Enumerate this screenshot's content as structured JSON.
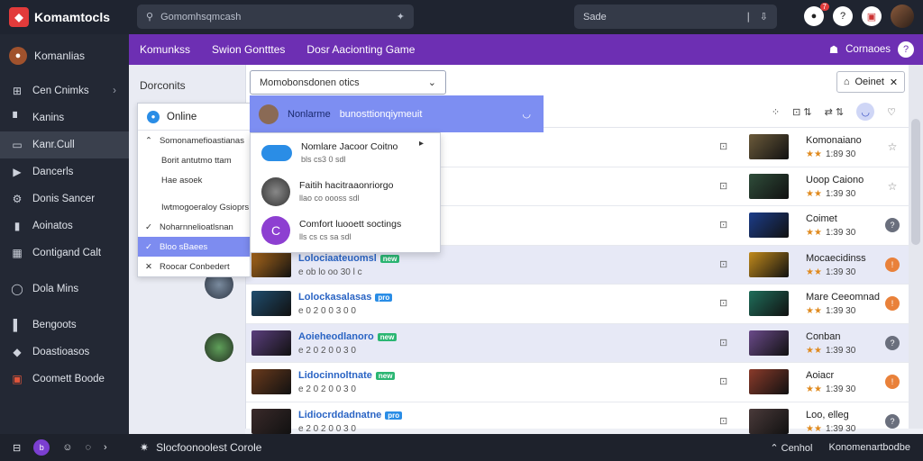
{
  "header": {
    "app_name": "Komamtocls",
    "search_placeholder": "Gomomhsqmcash",
    "search2_label": "Sade",
    "notif_count": "7"
  },
  "sidebar": {
    "user_name": "Komanlias",
    "items": [
      {
        "label": "Cen Cnimks",
        "icon": "game-controller-icon",
        "chevron": true
      },
      {
        "label": "Kanins",
        "icon": "trophy-icon"
      },
      {
        "label": "Kanr.Cull",
        "icon": "monitor-icon",
        "active": true
      },
      {
        "label": "Dancerls",
        "icon": "play-icon"
      },
      {
        "label": "Donis Sancer",
        "icon": "gear-icon"
      },
      {
        "label": "Aoinatos",
        "icon": "bookmark-icon"
      },
      {
        "label": "Contigand Calt",
        "icon": "calendar-icon"
      },
      {
        "label": "Dola Mins",
        "icon": "chat-icon"
      },
      {
        "label": "Bengoots",
        "icon": "book-icon"
      },
      {
        "label": "Doastioasos",
        "icon": "tag-icon"
      },
      {
        "label": "Coomett Boode",
        "icon": "badge-icon"
      }
    ]
  },
  "nav": {
    "tabs": [
      "Komunkss",
      "Swion Gontttes",
      "Dosr Aacionting Game"
    ],
    "right_label": "Cornaoes"
  },
  "left_panel": {
    "title": "Dorconits",
    "online_label": "Online",
    "items": [
      {
        "label": "Somonamefioastianas",
        "mark": "^"
      },
      {
        "label": "Borit antutmo ttam",
        "mark": ""
      },
      {
        "label": "Hae asoek",
        "mark": ""
      },
      {
        "label": "Iwtmogoeraloy Gsioprs",
        "mark": ""
      },
      {
        "label": "Noharnnelioatlsnan",
        "mark": "check"
      },
      {
        "label": "Bloo sBaees",
        "mark": "check",
        "selected": true
      },
      {
        "label": "Roocar Conbedert",
        "mark": "x"
      }
    ]
  },
  "main": {
    "select_value": "Momobonsdonen otics",
    "online_btn": "Oeinet",
    "highlight_row": {
      "name": "Nonlarme",
      "meta": "bunosttionqiymeuit"
    },
    "popup": [
      {
        "title": "Nomlare Jacoor Coitno",
        "sub": "bls cs3 0 sdl"
      },
      {
        "title": "Faitih hacitraaonriorgo",
        "sub": "llao co oooss sdl"
      },
      {
        "title": "Comfort luooett soctings",
        "sub": "lls cs cs sa sdl"
      }
    ],
    "rows": [
      {
        "title": "",
        "sub": "",
        "tag": "",
        "right_title": "Komonaiano",
        "rating": "1:89 30",
        "end": "star"
      },
      {
        "title": "",
        "sub": "",
        "tag": "",
        "right_title": "Uoop Caiono",
        "rating": "1:39 30",
        "end": "star"
      },
      {
        "title": "",
        "sub": "",
        "tag": "",
        "right_title": "Coimet",
        "rating": "1:39 30",
        "end": "q"
      },
      {
        "title": "Lolociaateuomsl",
        "sub": "e ob lo oo 30 l c",
        "tag": "new",
        "right_title": "Mocaecidinss",
        "rating": "1:39 30",
        "end": "o"
      },
      {
        "title": "Lolockasalasas",
        "sub": "e 0 2 0 0 3 0 0",
        "tag": "pro",
        "right_title": "Mare Ceeomnad",
        "rating": "1:39 30",
        "end": "o"
      },
      {
        "title": "Aoieheodlanoro",
        "sub": "e 2 0 2 0 0 3 0",
        "tag": "new",
        "right_title": "Conban",
        "rating": "1:39 30",
        "end": "q"
      },
      {
        "title": "Lidocinnoltnate",
        "sub": "e 2 0 2 0 0 3 0",
        "tag": "new",
        "right_title": "Aoiacr",
        "rating": "1:39 30",
        "end": "o"
      },
      {
        "title": "Lidiocrddadnatne",
        "sub": "e 2 0 2 0 0 3 0",
        "tag": "pro",
        "right_title": "Loo, elleg",
        "rating": "1:39 30",
        "end": "q"
      }
    ]
  },
  "bottom": {
    "status_text": "Slocfoonoolest Corole",
    "right_1": "Cenhol",
    "right_2": "Konomenartbodbe"
  },
  "colors": {
    "accent": "#6d2fb3",
    "sidebar_bg": "#232834",
    "highlight": "#7d8ef2"
  }
}
